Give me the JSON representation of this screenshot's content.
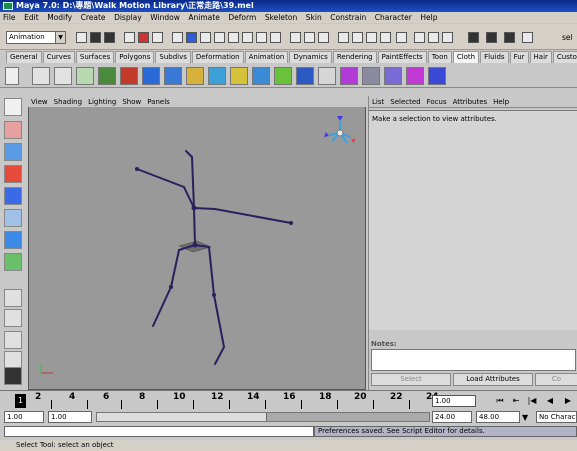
{
  "window": {
    "title": "Maya 7.0: D:\\專題\\Walk Motion Library\\正常走路\\39.mel"
  },
  "menubar": [
    "File",
    "Edit",
    "Modify",
    "Create",
    "Display",
    "Window",
    "Animate",
    "Deform",
    "Skeleton",
    "Skin",
    "Constrain",
    "Character",
    "Help"
  ],
  "statusline": {
    "mode": "Animation",
    "trailing_text": "sel"
  },
  "shelf_tabs": [
    "General",
    "Curves",
    "Surfaces",
    "Polygons",
    "Subdivs",
    "Deformation",
    "Animation",
    "Dynamics",
    "Rendering",
    "PaintEffects",
    "Toon",
    "Cloth",
    "Fluids",
    "Fur",
    "Hair",
    "Custom"
  ],
  "shelf_active_tab": "Cloth",
  "viewport": {
    "menu": [
      "View",
      "Shading",
      "Lighting",
      "Show",
      "Panels"
    ]
  },
  "attribute_editor": {
    "menu": [
      "List",
      "Selected",
      "Focus",
      "Attributes",
      "Help"
    ],
    "message": "Make a selection to view attributes.",
    "notes_label": "Notes:",
    "select_button": "Select",
    "load_button": "Load Attributes",
    "copy_button": "Co"
  },
  "timeslider": {
    "current_frame": "1",
    "ticks": [
      "2",
      "4",
      "6",
      "8",
      "10",
      "12",
      "14",
      "16",
      "18",
      "20",
      "22",
      "24"
    ],
    "time_field": "1.00"
  },
  "range": {
    "start_min": "1.00",
    "start": "1.00",
    "end": "24.00",
    "end_max": "48.00",
    "character_set": "No Character"
  },
  "command": {
    "result": "Preferences saved. See Script Editor for details."
  },
  "help_line": "Select Tool: select an object",
  "colors": {
    "title_bar": "#1d4fc2",
    "viewport_bg": "#999999",
    "skeleton": "#2b1f5c"
  }
}
